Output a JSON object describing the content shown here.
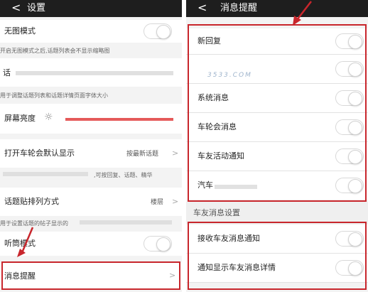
{
  "left": {
    "back_glyph": "<",
    "title": "设置",
    "rows": {
      "image_mode": {
        "label": "无图模式",
        "toggle_on": false
      },
      "image_mode_desc": "开启无图模式之后,话题列表会不显示缩略图",
      "font_size": {
        "label": "话"
      },
      "font_size_desc": "用于调整话题列表和话题详情页面字体大小",
      "brightness": {
        "label": "屏幕亮度",
        "icon": "sun-icon",
        "level_fraction": 1.0
      },
      "default_view": {
        "label": "打开车轮会默认显示",
        "value": "按最新话题",
        "chevron": ">"
      },
      "default_view_desc": ",可按回复、话题、精华",
      "sort": {
        "label": "话题贴排列方式",
        "value": "楼层",
        "chevron": ">"
      },
      "sort_desc": "用于设置话题的帖子显示的",
      "listen_mode": {
        "label": "听筒模式",
        "toggle_on": false
      },
      "notifications": {
        "label": "消息提醒",
        "chevron": ">"
      }
    }
  },
  "right": {
    "back_glyph": "<",
    "title": "消息提醒",
    "rows": [
      {
        "label": "新回复",
        "toggle_on": false
      },
      {
        "label": "",
        "toggle_on": false
      },
      {
        "label": "系统消息",
        "toggle_on": false
      },
      {
        "label": "车轮会消息",
        "toggle_on": false
      },
      {
        "label": "车友活动通知",
        "toggle_on": false
      },
      {
        "label": "汽车",
        "toggle_on": false
      }
    ],
    "section_title": "车友消息设置",
    "section_rows": [
      {
        "label": "接收车友消息通知",
        "toggle_on": false
      },
      {
        "label": "通知显示车友消息详情",
        "toggle_on": false
      }
    ],
    "watermark": "3533.COM"
  },
  "colors": {
    "titlebar": "#1e1e1e",
    "highlight": "#c8262c",
    "brightness_bar": "#e55a5a"
  }
}
